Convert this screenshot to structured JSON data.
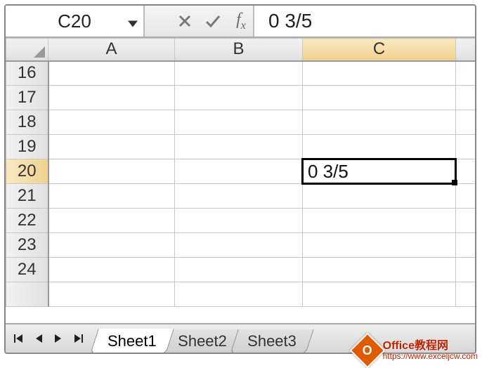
{
  "formula_bar": {
    "cell_reference": "C20",
    "cancel_tooltip": "Cancel",
    "enter_tooltip": "Enter",
    "fx_label": "fx",
    "formula_value": "0 3/5"
  },
  "columns": [
    "A",
    "B",
    "C"
  ],
  "rows": [
    16,
    17,
    18,
    19,
    20,
    21,
    22,
    23,
    24
  ],
  "active_cell": {
    "col": "C",
    "row": 20,
    "display_value": "0 3/5"
  },
  "tabs": {
    "items": [
      "Sheet1",
      "Sheet2",
      "Sheet3"
    ],
    "active_index": 0
  },
  "watermark": {
    "line1": "Office教程网",
    "line2": "https://www.exceljcw.com",
    "logo_letter": "O"
  }
}
